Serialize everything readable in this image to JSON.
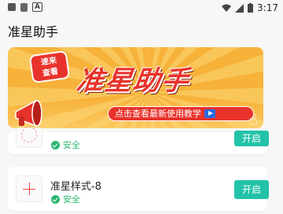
{
  "status_bar": {
    "time": "3:17",
    "icons": [
      "notification-icon",
      "sim-icon",
      "a-icon",
      "wifi-icon",
      "signal-icon",
      "battery-icon"
    ],
    "a_label": "A"
  },
  "app": {
    "title": "准星助手"
  },
  "banner": {
    "badge_line1": "速来",
    "badge_line2": "查看",
    "headline": "准星助手",
    "subtitle": "点击查看最新使用教学",
    "colors": {
      "primary_red": "#e8332c",
      "orange": "#f7b23a"
    }
  },
  "items": [
    {
      "name": "",
      "safe_label": "安全",
      "button_label": "开启"
    },
    {
      "name": "准星样式-8",
      "safe_label": "安全",
      "button_label": "开启"
    }
  ],
  "colors": {
    "accent_green": "#22c3a8",
    "safe_green": "#2bb673"
  }
}
